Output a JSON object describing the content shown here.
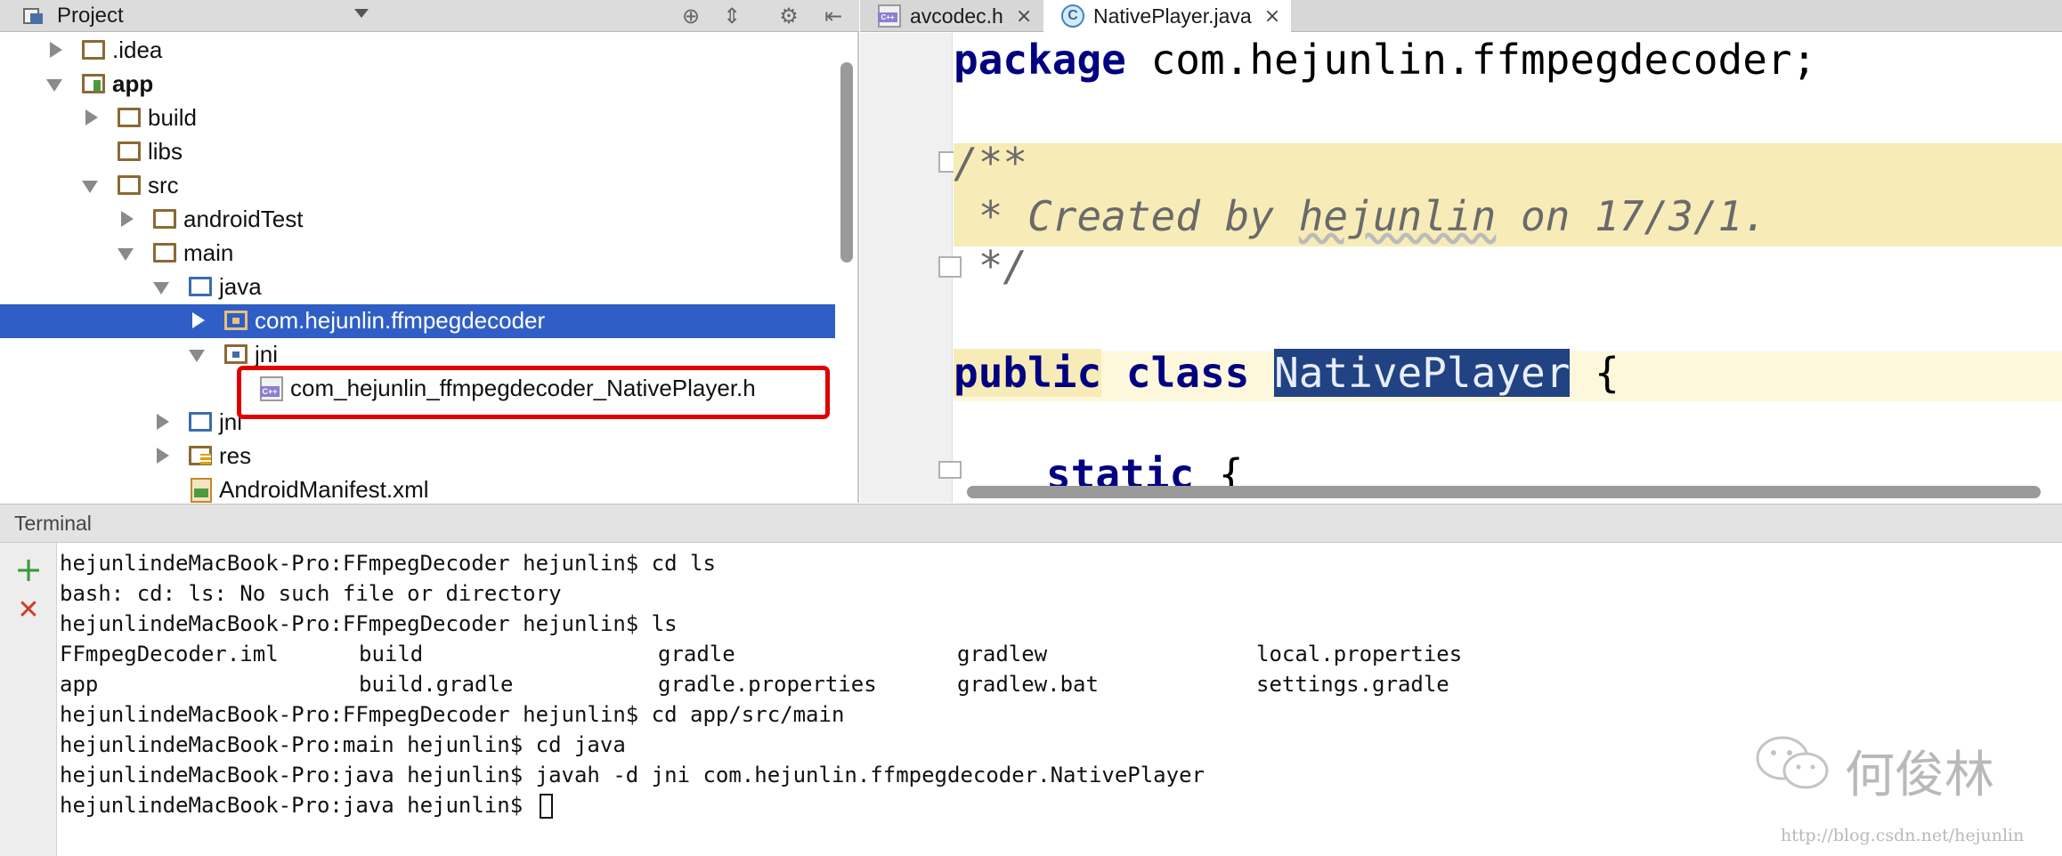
{
  "project_panel": {
    "title": "Project",
    "tree": [
      {
        "label": ".idea"
      },
      {
        "label": "app"
      },
      {
        "label": "build"
      },
      {
        "label": "libs"
      },
      {
        "label": "src"
      },
      {
        "label": "androidTest"
      },
      {
        "label": "main"
      },
      {
        "label": "java"
      },
      {
        "label": "com.hejunlin.ffmpegdecoder"
      },
      {
        "label": "jni"
      },
      {
        "label": "com_hejunlin_ffmpegdecoder_NativePlayer.h"
      },
      {
        "label": "jni"
      },
      {
        "label": "res"
      },
      {
        "label": "AndroidManifest.xml"
      }
    ]
  },
  "editor": {
    "tabs": [
      {
        "label": "avcodec.h",
        "icon": "cpp-header-icon"
      },
      {
        "label": "NativePlayer.java",
        "icon": "java-class-icon"
      }
    ],
    "code": {
      "l1_kw": "package",
      "l1_rest": " com.hejunlin.ffmpegdecoder;",
      "l2": "/**",
      "l3_a": " * Created by ",
      "l3_b": "hejunlin",
      "l3_c": " on 17/3/1.",
      "l4": " */",
      "l5_kw1": "public",
      "l5_kw2": "class",
      "l5_cls": "NativePlayer",
      "l5_brace": " {",
      "l6_kw": "static",
      "l6_rest": " {"
    }
  },
  "terminal": {
    "title": "Terminal",
    "add_glyph": "+",
    "close_glyph": "✕",
    "lines": [
      "hejunlindeMacBook-Pro:FFmpegDecoder hejunlin$ cd ls",
      "bash: cd: ls: No such file or directory",
      "hejunlindeMacBook-Pro:FFmpegDecoder hejunlin$ ls"
    ],
    "ls_row1": [
      "FFmpegDecoder.iml",
      "build",
      "gradle",
      "gradlew",
      "local.properties"
    ],
    "ls_row2": [
      "app",
      "build.gradle",
      "gradle.properties",
      "gradlew.bat",
      "settings.gradle"
    ],
    "lines_after": [
      "hejunlindeMacBook-Pro:FFmpegDecoder hejunlin$ cd app/src/main",
      "hejunlindeMacBook-Pro:main hejunlin$ cd java",
      "hejunlindeMacBook-Pro:java hejunlin$ javah -d jni com.hejunlin.ffmpegdecoder.NativePlayer",
      "hejunlindeMacBook-Pro:java hejunlin$ "
    ]
  },
  "watermark": {
    "name": "何俊林",
    "url": "http://blog.csdn.net/hejunlin"
  },
  "colors": {
    "selection": "#2f5fc6",
    "highlight_box": "#e00000",
    "keyword": "#000080",
    "doc_comment_bg": "#f7ecb8"
  }
}
